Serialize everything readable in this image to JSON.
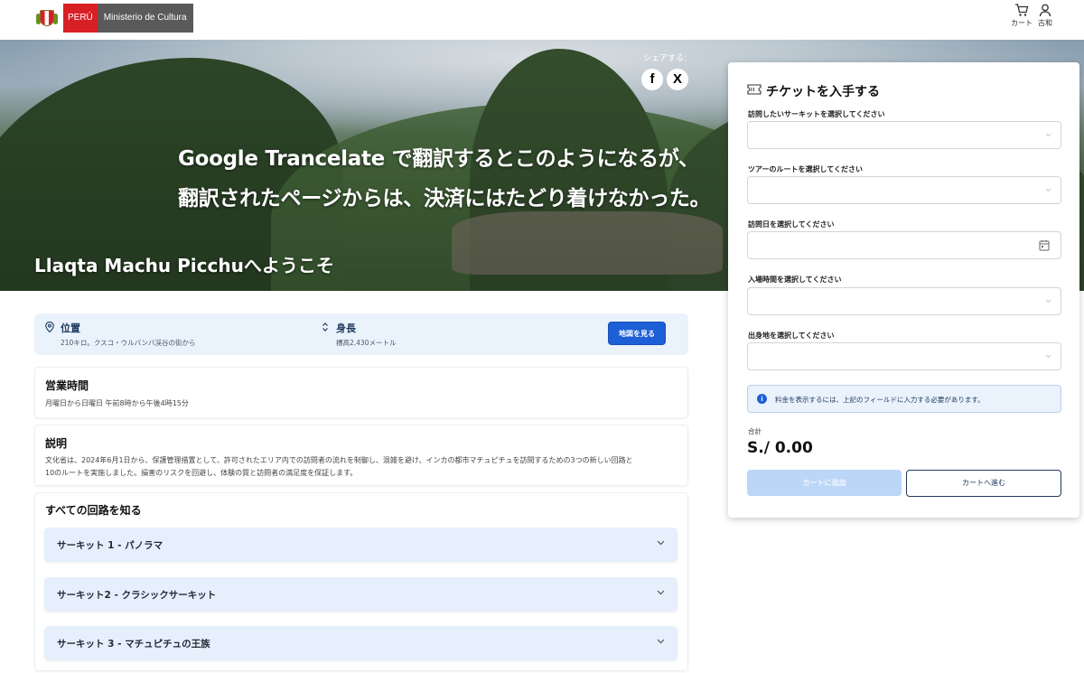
{
  "header": {
    "logo_country": "PERÚ",
    "logo_ministry": "Ministerio de Cultura",
    "cart_label": "カート",
    "account_label": "古和"
  },
  "hero": {
    "share_label": "シェアする:",
    "facebook_glyph": "f",
    "x_glyph": "X",
    "caption_line1": "Google Trancelate で翻訳するとこのようになるが、",
    "caption_line2": "翻訳されたページからは、決済にはたどり着けなかった。",
    "title": "Llaqta Machu Picchuへようこそ"
  },
  "info": {
    "location_title": "位置",
    "location_sub": "210キロ。クスコ・ウルバンバ渓谷の街から",
    "height_title": "身長",
    "height_sub": "標高2,430メートル",
    "map_button": "地図を見る"
  },
  "hours": {
    "heading": "営業時間",
    "text": "月曜日から日曜日 午前8時から午後4時15分"
  },
  "description": {
    "heading": "説明",
    "line1": "文化省は、2024年6月1日から、保護管理措置として、許可されたエリア内での訪問者の流れを制御し、混雑を避け、インカの都市マチュピチュを訪問するための3つの新しい回路と",
    "line2": "10のルートを実施しました。損害のリスクを回避し、体験の質と訪問者の満足度を保証します。"
  },
  "circuits": {
    "heading": "すべての回路を知る",
    "items": [
      {
        "label": "サーキット 1 - パノラマ"
      },
      {
        "label": "サーキット2 - クラシックサーキット"
      },
      {
        "label": "サーキット 3 - マチュピチュの王族"
      }
    ]
  },
  "ticket": {
    "title": "チケットを入手する",
    "circuit_label": "訪問したいサーキットを選択してください",
    "route_label": "ツアーのルートを選択してください",
    "date_label": "訪問日を選択してください",
    "time_label": "入場時間を選択してください",
    "origin_label": "出身地を選択してください",
    "notice": "料金を表示するには、上記のフィールドに入力する必要があります。",
    "total_label": "合計",
    "total_value": "S./ 0.00",
    "add_button": "カートに追加",
    "go_button": "カートへ進む"
  },
  "colors": {
    "accent": "#1d5fd6",
    "peru_red": "#d91f26",
    "info_bg": "#eaf2fc"
  },
  "icons": [
    "cart-icon",
    "user-icon",
    "facebook-icon",
    "x-icon",
    "location-pin-icon",
    "height-icon",
    "ticket-icon",
    "chevron-down-icon",
    "calendar-icon",
    "info-icon"
  ]
}
